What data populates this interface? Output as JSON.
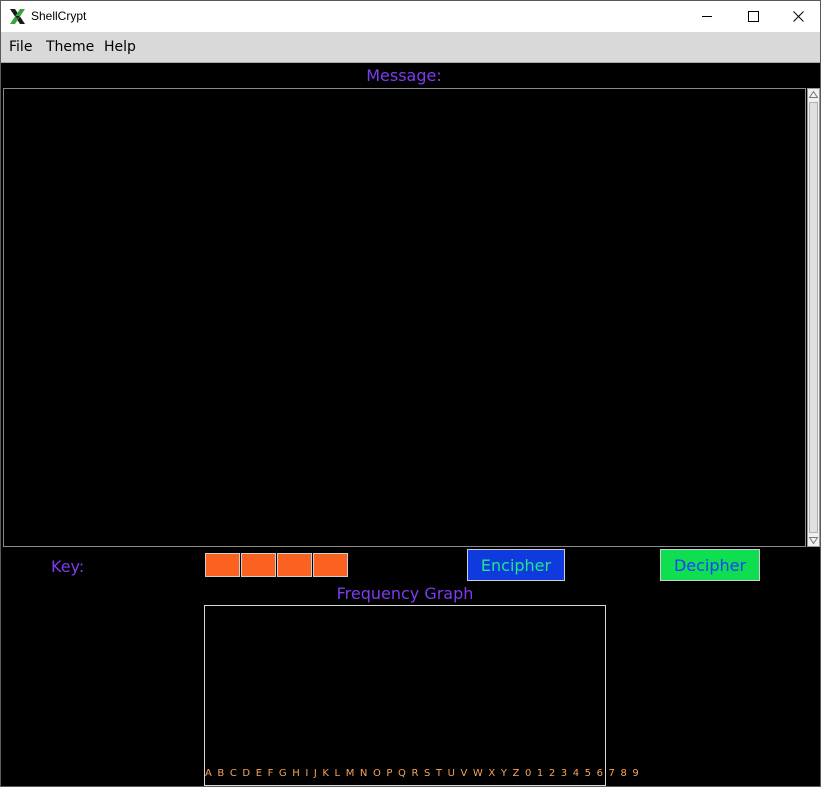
{
  "window": {
    "title": "ShellCrypt",
    "icons": {
      "app": "x-logo-icon",
      "minimize": "minimize-icon",
      "maximize": "maximize-icon",
      "close": "close-icon"
    }
  },
  "menu": {
    "file": "File",
    "theme": "Theme",
    "help": "Help"
  },
  "message": {
    "label": "Message:",
    "text": ""
  },
  "key": {
    "label": "Key:",
    "slots": [
      "",
      "",
      "",
      ""
    ]
  },
  "actions": {
    "encipher": "Encipher",
    "decipher": "Decipher"
  },
  "frequency": {
    "title": "Frequency Graph",
    "axis_labels": "A B C D E F G H I J K L M N O P Q R S T U V W X Y Z 0 1 2 3 4 5 6 7 8 9"
  },
  "colors": {
    "background": "#000000",
    "label": "#7d3cf0",
    "key_box": "#fb6120",
    "encipher_bg": "#0f3bde",
    "encipher_text": "#1ee68c",
    "decipher_bg": "#0fde50",
    "decipher_text": "#1642ff",
    "axis_text": "#f5a45a"
  }
}
